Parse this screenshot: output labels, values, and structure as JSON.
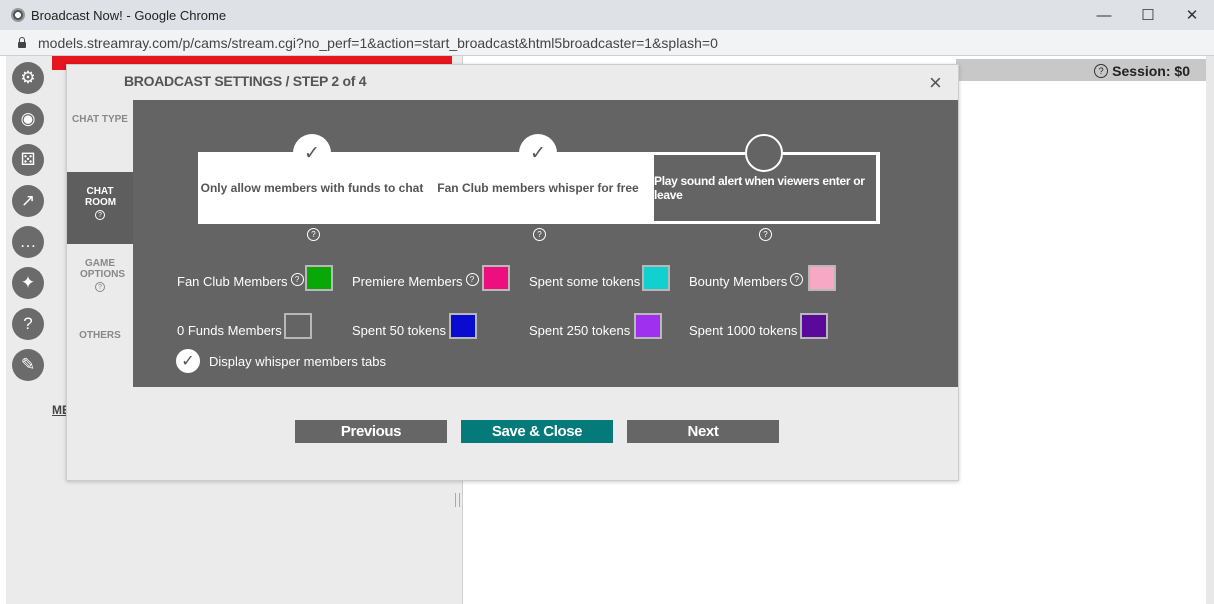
{
  "window": {
    "title": "Broadcast Now! - Google Chrome",
    "minimize": "—",
    "maximize": "☐",
    "close": "✕"
  },
  "address": {
    "url": "models.streamray.com/p/cams/stream.cgi?no_perf=1&action=start_broadcast&html5broadcaster=1&splash=0"
  },
  "page": {
    "session_label": "Session: $0",
    "me_link": "ME",
    "left_icons": [
      "gear-icon",
      "play-circle-icon",
      "dice-icon",
      "chart-icon",
      "chat-icon",
      "twitter-icon",
      "help-icon",
      "broadcast-icon"
    ]
  },
  "modal": {
    "title": "BROADCAST SETTINGS / STEP 2 of 4",
    "close": "×",
    "tabs": [
      {
        "label": "CHAT TYPE",
        "active": false
      },
      {
        "label": "CHAT ROOM",
        "active": true
      },
      {
        "label": "GAME OPTIONS",
        "active": false
      },
      {
        "label": "OTHERS",
        "active": false
      }
    ],
    "steps": [
      {
        "label": "Only allow members with funds to chat",
        "checked": true
      },
      {
        "label": "Fan Club members whisper for free",
        "checked": true
      },
      {
        "label": "Play sound alert when viewers enter or leave",
        "checked": false
      }
    ],
    "colors_row1": [
      {
        "label": "Fan Club Members",
        "help": true,
        "color": "#08a808"
      },
      {
        "label": "Premiere Members",
        "help": true,
        "color": "#ee0f7f"
      },
      {
        "label": "Spent some tokens",
        "help": false,
        "color": "#10d0d0"
      },
      {
        "label": "Bounty Members",
        "help": true,
        "color": "#f7a8c4"
      }
    ],
    "colors_row2": [
      {
        "label": "0 Funds Members",
        "help": false,
        "color": "#646464"
      },
      {
        "label": "Spent 50 tokens",
        "help": false,
        "color": "#0a0ad0"
      },
      {
        "label": "Spent 250 tokens",
        "help": false,
        "color": "#a030f0"
      },
      {
        "label": "Spent 1000 tokens",
        "help": false,
        "color": "#5a0a9a"
      }
    ],
    "whisper_tabs": {
      "label": "Display whisper members tabs",
      "checked": true
    },
    "buttons": {
      "previous": "Previous",
      "save": "Save & Close",
      "next": "Next"
    }
  }
}
